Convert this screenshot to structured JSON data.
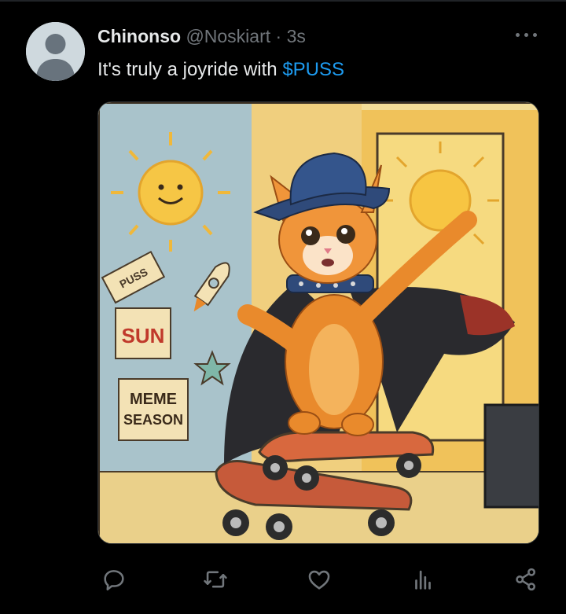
{
  "tweet": {
    "author_name": "Chinonso",
    "handle": "@Noskiart",
    "separator": "·",
    "time": "3s",
    "text_prefix": "It's truly a joyride with ",
    "cashtag": "$PUSS"
  },
  "media": {
    "sign_puss": "PUSS",
    "sign_sun": "SUN",
    "sign_meme": "MEME",
    "sign_season": "SEASON"
  },
  "icons": {
    "more": "more-horizontal-icon",
    "reply": "reply-icon",
    "retweet": "retweet-icon",
    "like": "like-icon",
    "views": "views-icon",
    "share": "share-icon"
  },
  "colors": {
    "background": "#000000",
    "text": "#e7e9ea",
    "muted": "#71767b",
    "link": "#1d9bf0"
  }
}
